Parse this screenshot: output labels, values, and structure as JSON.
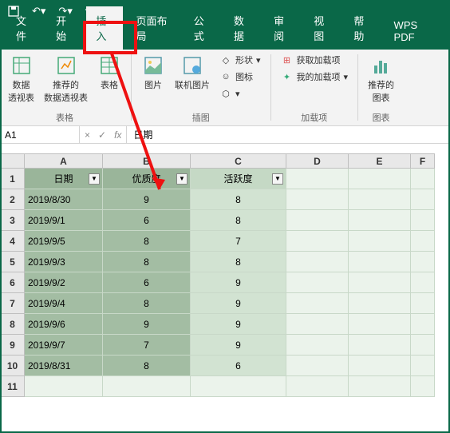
{
  "titlebar": {
    "save": "💾",
    "undo": "↶",
    "redo": "↷"
  },
  "menu": {
    "items": [
      "文件",
      "开始",
      "插入",
      "页面布局",
      "公式",
      "数据",
      "审阅",
      "视图",
      "帮助",
      "WPS PDF"
    ],
    "active_index": 2
  },
  "ribbon": {
    "group1": {
      "label": "表格",
      "pivot": "数据\n透视表",
      "rec_pivot": "推荐的\n数据透视表",
      "table": "表格"
    },
    "group2": {
      "label": "插图",
      "pic": "图片",
      "online_pic": "联机图片",
      "shapes": "形状",
      "icons": "图标",
      "model3d": "3D 模型"
    },
    "group3": {
      "label": "加载项",
      "get": "获取加载项",
      "mine": "我的加载项"
    },
    "group4": {
      "label": "图表",
      "rec_chart": "推荐的\n图表"
    }
  },
  "formula_bar": {
    "name": "A1",
    "fx": "fx",
    "content": "日期"
  },
  "sheet": {
    "cols": [
      "A",
      "B",
      "C",
      "D",
      "E",
      "F"
    ],
    "row_nums": [
      1,
      2,
      3,
      4,
      5,
      6,
      7,
      8,
      9,
      10,
      11
    ],
    "headers": [
      "日期",
      "优质度",
      "活跃度"
    ],
    "rows": [
      {
        "a": "2019/8/30",
        "b": "9",
        "c": "8"
      },
      {
        "a": "2019/9/1",
        "b": "6",
        "c": "8"
      },
      {
        "a": "2019/9/5",
        "b": "8",
        "c": "7"
      },
      {
        "a": "2019/9/3",
        "b": "8",
        "c": "8"
      },
      {
        "a": "2019/9/2",
        "b": "6",
        "c": "9"
      },
      {
        "a": "2019/9/4",
        "b": "8",
        "c": "9"
      },
      {
        "a": "2019/9/6",
        "b": "9",
        "c": "9"
      },
      {
        "a": "2019/9/7",
        "b": "7",
        "c": "9"
      },
      {
        "a": "2019/8/31",
        "b": "8",
        "c": "6"
      }
    ]
  }
}
